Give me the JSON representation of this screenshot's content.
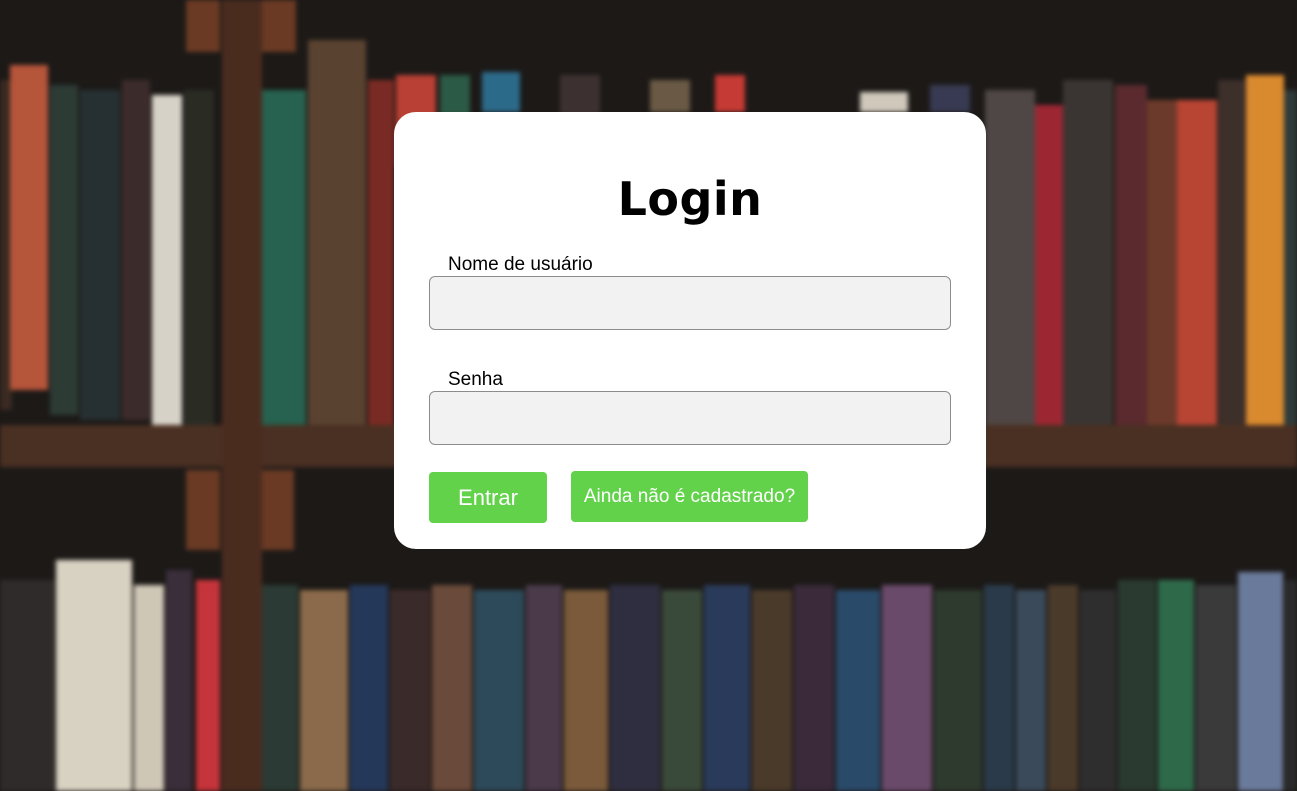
{
  "login": {
    "title": "Login",
    "username_label": "Nome de usuário",
    "username_value": "",
    "password_label": "Senha",
    "password_value": "",
    "enter_button": "Entrar",
    "signup_button": "Ainda não é cadastrado?"
  },
  "colors": {
    "button": "#62d24b",
    "input_bg": "#f2f2f2",
    "card_bg": "#ffffff",
    "backdrop": "#1e1a18"
  },
  "background": {
    "image": "blurred-bookshelf"
  }
}
